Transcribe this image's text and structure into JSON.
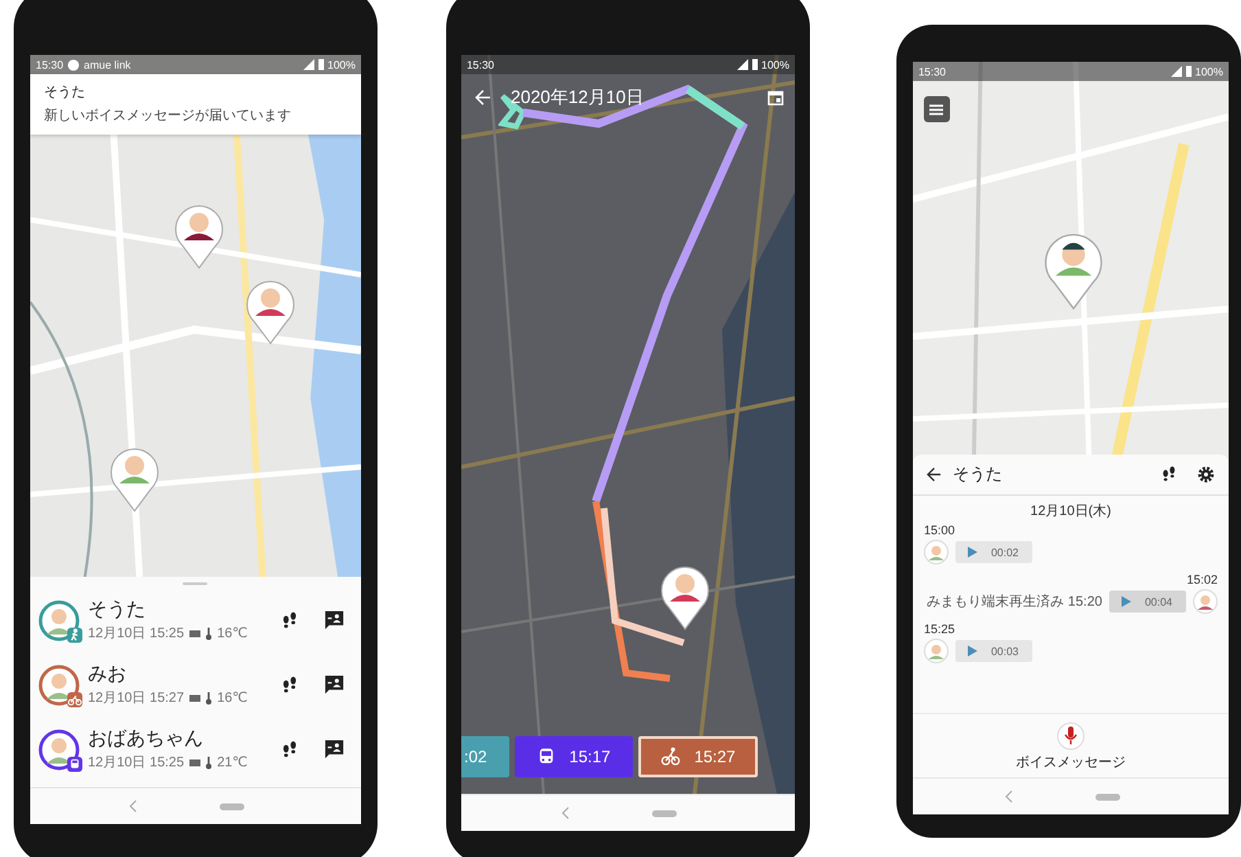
{
  "home_screen": {
    "status_bar": {
      "time": "15:30",
      "app_name": "amue link",
      "battery": "100%"
    },
    "notification": {
      "title": "そうた",
      "message": "新しいボイスメッセージが届いています"
    },
    "members": [
      {
        "name": "そうた",
        "updated": "12月10日 15:25",
        "temperature": "16℃",
        "color": "#3a9c9c",
        "kind": "walk"
      },
      {
        "name": "みお",
        "updated": "12月10日 15:27",
        "temperature": "16℃",
        "color": "#c0674a",
        "kind": "bike"
      },
      {
        "name": "おばあちゃん",
        "updated": "12月10日 15:25",
        "temperature": "21℃",
        "color": "#6236e8",
        "kind": "train"
      }
    ]
  },
  "route_screen": {
    "status_bar": {
      "time": "15:30",
      "battery": "100%"
    },
    "title": "2020年12月10日",
    "segments": [
      {
        "time": ":02",
        "color": "#4a9fae",
        "kind": "plain",
        "selected": false
      },
      {
        "time": "15:17",
        "color": "#5a2ee6",
        "kind": "train",
        "selected": false
      },
      {
        "time": "15:27",
        "color": "#b8603f",
        "kind": "bike",
        "selected": true
      }
    ]
  },
  "chat_screen": {
    "status_bar": {
      "time": "15:30",
      "battery": "100%"
    },
    "contact": "そうた",
    "date": "12月10日(木)",
    "messages": [
      {
        "kind": "received",
        "time": "15:00",
        "duration": "00:02"
      },
      {
        "kind": "sent",
        "time": "15:02",
        "duration": "00:04",
        "read_status": "みまもり端末再生済み 15:20"
      },
      {
        "kind": "received",
        "time": "15:25",
        "duration": "00:03"
      }
    ],
    "voice_button": "ボイスメッセージ"
  }
}
